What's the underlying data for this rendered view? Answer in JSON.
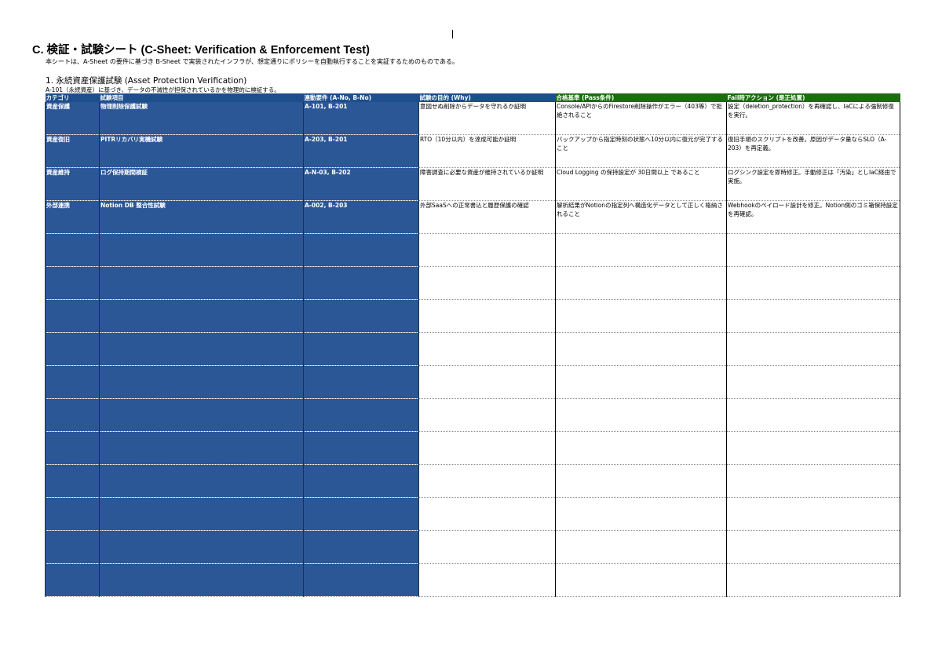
{
  "sheet": {
    "title": "C. 検証・試験シート (C-Sheet: Verification & Enforcement Test)",
    "description": "本シートは、A-Sheet の要件に基づき B-Sheet で実装されたインフラが、想定通りにポリシーを自動執行することを実証するためのものである。"
  },
  "section": {
    "title": "1. 永続資産保護試験 (Asset Protection Verification)",
    "subtitle": "A-101（永続資産）に基づき、データの不滅性が担保されているかを物理的に検証する。"
  },
  "table": {
    "headers": [
      "カテゴリ",
      "試験項目",
      "連動要件 (A-No, B-No)",
      "試験の目的 (Why)",
      "合格基準 (Pass条件)",
      "Fail時アクション (是正処置)"
    ],
    "rows": [
      {
        "category": "資産保護",
        "item": "物理削除保護試験",
        "link": "A-101, B-201",
        "purpose": "意図せぬ削除からデータを守れるか証明",
        "pass": "Console/APIからのFirestore削除操作がエラー（403等）で拒絶されること",
        "action": "設定（deletion_protection）を再確認し、IaCによる強制修復を実行。"
      },
      {
        "category": "資産復旧",
        "item": "PITRリカバリ実機試験",
        "link": "A-203, B-201",
        "purpose": "RTO（10分以内）を達成可能か証明",
        "pass": "バックアップから指定時刻の状態へ10分以内に復元が完了すること",
        "action": "復旧手順のスクリプトを改善。原因がデータ量ならSLO（A-203）を再定義。"
      },
      {
        "category": "資産維持",
        "item": "ログ保持期間検証",
        "link": "A-N-03, B-202",
        "purpose": "障害調査に必要な資産が維持されているか証明",
        "pass": "Cloud Logging の保持設定が 30日間以上 であること",
        "action": "ログシンク設定を即時修正。手動修正は「汚染」としIaC経由で実施。"
      },
      {
        "category": "外部連携",
        "item": "Notion DB 整合性試験",
        "link": "A-002, B-203",
        "purpose": "外部SaaSへの正常書込と履歴保護の確認",
        "pass": "解析結果がNotionの指定列へ構造化データとして正しく格納されること",
        "action": "Webhookのペイロード設計を修正。Notion側のゴミ箱保持設定を再確認。"
      }
    ],
    "empty_row_count": 11
  },
  "colors": {
    "header_blue": "#1f4e8c",
    "header_green": "#1e6b13",
    "cell_blue": "#2b5797"
  }
}
